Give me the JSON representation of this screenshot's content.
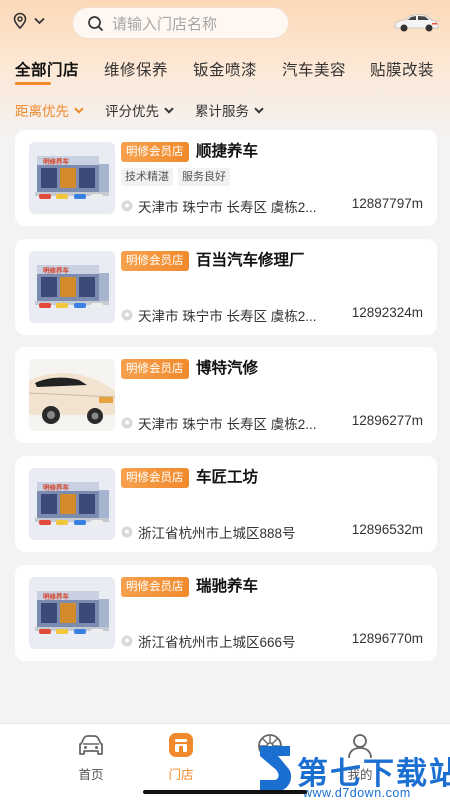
{
  "header": {
    "search_placeholder": "请输入门店名称"
  },
  "tabs": [
    {
      "label": "全部门店",
      "active": true
    },
    {
      "label": "维修保养",
      "active": false
    },
    {
      "label": "钣金喷漆",
      "active": false
    },
    {
      "label": "汽车美容",
      "active": false
    },
    {
      "label": "贴膜改装",
      "active": false
    }
  ],
  "filters": [
    {
      "label": "距离优先",
      "active": true
    },
    {
      "label": "评分优先",
      "active": false
    },
    {
      "label": "累计服务",
      "active": false
    }
  ],
  "stores": [
    {
      "badge": "明修会员店",
      "name": "顺捷养车",
      "tags": [
        "技术精湛",
        "服务良好"
      ],
      "address": "天津市 珠宁市 长寿区 虞栋2...",
      "distance": "12887797m",
      "thumb": "storefront"
    },
    {
      "badge": "明修会员店",
      "name": "百当汽车修理厂",
      "tags": [],
      "address": "天津市 珠宁市 长寿区 虞栋2...",
      "distance": "12892324m",
      "thumb": "storefront"
    },
    {
      "badge": "明修会员店",
      "name": "博特汽修",
      "tags": [],
      "address": "天津市 珠宁市 长寿区 虞栋2...",
      "distance": "12896277m",
      "thumb": "car"
    },
    {
      "badge": "明修会员店",
      "name": "车匠工坊",
      "tags": [],
      "address": "浙江省杭州市上城区888号",
      "distance": "12896532m",
      "thumb": "storefront"
    },
    {
      "badge": "明修会员店",
      "name": "瑞驰养车",
      "tags": [],
      "address": "浙江省杭州市上城区666号",
      "distance": "12896770m",
      "thumb": "storefront"
    }
  ],
  "storefront_sign": "明修养车",
  "bottom_nav": [
    {
      "label": "首页",
      "icon": "car-face-icon",
      "active": false
    },
    {
      "label": "门店",
      "icon": "store-icon",
      "active": true
    },
    {
      "label": "",
      "icon": "wheel-icon",
      "active": false
    },
    {
      "label": "我的",
      "icon": "profile-icon",
      "active": false
    }
  ],
  "watermark": {
    "title": "第七下载站",
    "url": "www.d7down.com"
  },
  "colors": {
    "accent": "#f08a2c",
    "badge": "#f7a14e",
    "watermark": "#1a6fd1"
  }
}
